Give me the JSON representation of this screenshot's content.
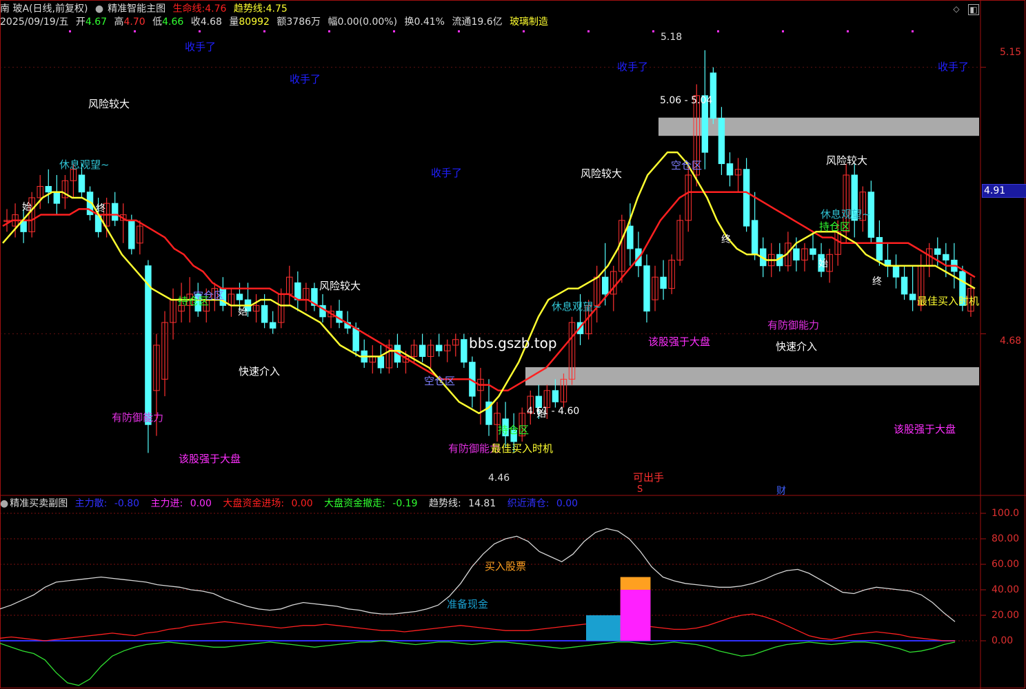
{
  "header": {
    "stock_name": "南 玻A(日线,前复权)",
    "indicator_name": "精准智能主图",
    "life_line_label": "生命线:",
    "life_line_value": "4.76",
    "trend_line_label": "趋势线:",
    "trend_line_value": "4.75",
    "date": "2025/09/19/五",
    "open_label": "开",
    "open_value": "4.67",
    "high_label": "高",
    "high_value": "4.70",
    "low_label": "低",
    "low_value": "4.66",
    "close_label": "收",
    "close_value": "4.68",
    "volume_label": "量",
    "volume_value": "80992",
    "amount_label": "额",
    "amount_value": "3786万",
    "change_label": "幅",
    "change_value": "0.00(0.00%)",
    "turnover_label": "换",
    "turnover_value": "0.41%",
    "float_label": "流通",
    "float_value": "19.6亿",
    "sector": "玻璃制造"
  },
  "sub_header": {
    "name": "精准买卖副图",
    "items": [
      {
        "label": "主力散:",
        "value": "-0.80",
        "color": "#3030ff"
      },
      {
        "label": "主力进:",
        "value": "0.00",
        "color": "#ff30ff"
      },
      {
        "label": "大盘资金进场:",
        "value": "0.00",
        "color": "#ff2020"
      },
      {
        "label": "大盘资金撤走:",
        "value": "-0.19",
        "color": "#30ff30"
      },
      {
        "label": "趋势线:",
        "value": "14.81",
        "color": "#e0e0e0"
      },
      {
        "label": "织近清仓:",
        "value": "0.00",
        "color": "#3030ff"
      }
    ]
  },
  "price_axis": {
    "ticks": [
      "5.15",
      "4.68"
    ],
    "current": "4.91"
  },
  "sub_axis": {
    "ticks": [
      "100.0",
      "80.00",
      "60.00",
      "40.00",
      "20.00",
      "0.00"
    ]
  },
  "annotations": {
    "shou_shou_le": "收手了",
    "risk_big": "风险较大",
    "rest_watch": "休息观望~",
    "empty_zone": "空仓区",
    "hold_zone": "持仓区",
    "defense": "有防御能力",
    "stronger": "该股强于大盘",
    "quick_enter": "快速介入",
    "best_buy": "最佳买入时机",
    "can_exit": "可出手",
    "start": "始",
    "end": "终",
    "cai": "财",
    "s_mark": "S",
    "watermark_site": "bbs.gszb.top",
    "high_mark": "5.18",
    "low_mark": "4.46",
    "range_top": "5.06 - 5.04",
    "range_bottom": "4.61 - 4.60",
    "buy_stock": "买入股票",
    "prepare_cash": "准备现金"
  },
  "chart_data": {
    "type": "candlestick",
    "ylim": [
      4.4,
      5.22
    ],
    "sub_ylim": [
      -35,
      105
    ],
    "colors": {
      "up": "#ff3030",
      "down": "#54ffff",
      "life_line": "#ff2020",
      "trend_line": "#ffff30",
      "zone": "#aaaaaa"
    },
    "zones": [
      [
        5.04,
        5.06
      ],
      [
        4.6,
        4.62
      ]
    ],
    "candles": [
      [
        4.88,
        4.9,
        4.86,
        4.88
      ],
      [
        4.87,
        4.91,
        4.85,
        4.89
      ],
      [
        4.88,
        4.9,
        4.84,
        4.86
      ],
      [
        4.86,
        4.93,
        4.85,
        4.92
      ],
      [
        4.92,
        4.96,
        4.9,
        4.94
      ],
      [
        4.94,
        4.97,
        4.91,
        4.93
      ],
      [
        4.93,
        4.96,
        4.89,
        4.91
      ],
      [
        4.92,
        4.96,
        4.9,
        4.95
      ],
      [
        4.95,
        4.98,
        4.92,
        4.97
      ],
      [
        4.96,
        4.98,
        4.92,
        4.93
      ],
      [
        4.93,
        4.94,
        4.88,
        4.89
      ],
      [
        4.89,
        4.92,
        4.85,
        4.86
      ],
      [
        4.87,
        4.92,
        4.85,
        4.91
      ],
      [
        4.91,
        4.93,
        4.87,
        4.88
      ],
      [
        4.88,
        4.91,
        4.84,
        4.89
      ],
      [
        4.88,
        4.89,
        4.82,
        4.83
      ],
      [
        4.84,
        4.88,
        4.82,
        4.87
      ],
      [
        4.8,
        4.81,
        4.47,
        4.52
      ],
      [
        4.58,
        4.68,
        4.5,
        4.66
      ],
      [
        4.6,
        4.72,
        4.57,
        4.7
      ],
      [
        4.7,
        4.76,
        4.67,
        4.74
      ],
      [
        4.72,
        4.77,
        4.7,
        4.73
      ],
      [
        4.73,
        4.78,
        4.7,
        4.75
      ],
      [
        4.75,
        4.77,
        4.71,
        4.72
      ],
      [
        4.72,
        4.76,
        4.7,
        4.74
      ],
      [
        4.74,
        4.77,
        4.72,
        4.76
      ],
      [
        4.76,
        4.78,
        4.72,
        4.73
      ],
      [
        4.73,
        4.76,
        4.71,
        4.75
      ],
      [
        4.75,
        4.77,
        4.72,
        4.74
      ],
      [
        4.74,
        4.77,
        4.71,
        4.72
      ],
      [
        4.72,
        4.75,
        4.7,
        4.73
      ],
      [
        4.73,
        4.75,
        4.69,
        4.7
      ],
      [
        4.7,
        4.72,
        4.68,
        4.69
      ],
      [
        4.7,
        4.76,
        4.69,
        4.75
      ],
      [
        4.75,
        4.8,
        4.73,
        4.78
      ],
      [
        4.77,
        4.79,
        4.72,
        4.74
      ],
      [
        4.74,
        4.77,
        4.72,
        4.76
      ],
      [
        4.76,
        4.77,
        4.72,
        4.73
      ],
      [
        4.73,
        4.75,
        4.7,
        4.71
      ],
      [
        4.71,
        4.73,
        4.69,
        4.72
      ],
      [
        4.72,
        4.74,
        4.69,
        4.7
      ],
      [
        4.7,
        4.72,
        4.68,
        4.69
      ],
      [
        4.69,
        4.7,
        4.64,
        4.65
      ],
      [
        4.65,
        4.67,
        4.62,
        4.63
      ],
      [
        4.63,
        4.66,
        4.61,
        4.64
      ],
      [
        4.64,
        4.66,
        4.61,
        4.62
      ],
      [
        4.62,
        4.67,
        4.61,
        4.66
      ],
      [
        4.66,
        4.68,
        4.62,
        4.63
      ],
      [
        4.63,
        4.65,
        4.61,
        4.64
      ],
      [
        4.64,
        4.67,
        4.63,
        4.66
      ],
      [
        4.66,
        4.68,
        4.63,
        4.64
      ],
      [
        4.64,
        4.67,
        4.62,
        4.66
      ],
      [
        4.66,
        4.68,
        4.64,
        4.65
      ],
      [
        4.65,
        4.67,
        4.63,
        4.66
      ],
      [
        4.66,
        4.68,
        4.64,
        4.67
      ],
      [
        4.67,
        4.68,
        4.62,
        4.63
      ],
      [
        4.63,
        4.64,
        4.55,
        4.57
      ],
      [
        4.58,
        4.62,
        4.52,
        4.6
      ],
      [
        4.56,
        4.6,
        4.5,
        4.52
      ],
      [
        4.52,
        4.56,
        4.49,
        4.54
      ],
      [
        4.53,
        4.56,
        4.48,
        4.5
      ],
      [
        4.51,
        4.54,
        4.47,
        4.49
      ],
      [
        4.5,
        4.55,
        4.49,
        4.54
      ],
      [
        4.54,
        4.58,
        4.52,
        4.57
      ],
      [
        4.57,
        4.59,
        4.53,
        4.55
      ],
      [
        4.55,
        4.59,
        4.53,
        4.58
      ],
      [
        4.58,
        4.6,
        4.55,
        4.56
      ],
      [
        4.56,
        4.61,
        4.55,
        4.6
      ],
      [
        4.6,
        4.71,
        4.59,
        4.7
      ],
      [
        4.7,
        4.75,
        4.66,
        4.68
      ],
      [
        4.68,
        4.74,
        4.67,
        4.73
      ],
      [
        4.73,
        4.8,
        4.7,
        4.78
      ],
      [
        4.78,
        4.84,
        4.73,
        4.75
      ],
      [
        4.75,
        4.8,
        4.72,
        4.79
      ],
      [
        4.79,
        4.89,
        4.77,
        4.88
      ],
      [
        4.87,
        4.91,
        4.8,
        4.83
      ],
      [
        4.83,
        4.86,
        4.78,
        4.8
      ],
      [
        4.8,
        4.82,
        4.7,
        4.72
      ],
      [
        4.74,
        4.8,
        4.72,
        4.78
      ],
      [
        4.78,
        4.81,
        4.74,
        4.76
      ],
      [
        4.76,
        4.82,
        4.75,
        4.81
      ],
      [
        4.81,
        4.89,
        4.8,
        4.88
      ],
      [
        4.88,
        4.98,
        4.86,
        4.96
      ],
      [
        4.96,
        5.12,
        4.94,
        5.1
      ],
      [
        5.1,
        5.18,
        4.97,
        5.0
      ],
      [
        5.14,
        5.15,
        5.05,
        5.06
      ],
      [
        5.06,
        5.08,
        4.96,
        4.98
      ],
      [
        4.98,
        5.0,
        4.94,
        4.96
      ],
      [
        4.96,
        4.99,
        4.93,
        4.97
      ],
      [
        4.97,
        4.99,
        4.86,
        4.87
      ],
      [
        4.88,
        4.93,
        4.81,
        4.82
      ],
      [
        4.83,
        4.85,
        4.78,
        4.8
      ],
      [
        4.8,
        4.84,
        4.78,
        4.82
      ],
      [
        4.82,
        4.84,
        4.79,
        4.8
      ],
      [
        4.8,
        4.86,
        4.79,
        4.84
      ],
      [
        4.83,
        4.85,
        4.79,
        4.81
      ],
      [
        4.81,
        4.84,
        4.79,
        4.83
      ],
      [
        4.83,
        4.86,
        4.81,
        4.82
      ],
      [
        4.82,
        4.84,
        4.78,
        4.79
      ],
      [
        4.79,
        4.83,
        4.77,
        4.82
      ],
      [
        4.82,
        4.88,
        4.8,
        4.86
      ],
      [
        4.86,
        4.98,
        4.84,
        4.96
      ],
      [
        4.96,
        4.98,
        4.85,
        4.88
      ],
      [
        4.88,
        4.94,
        4.86,
        4.93
      ],
      [
        4.93,
        4.95,
        4.84,
        4.85
      ],
      [
        4.85,
        4.88,
        4.8,
        4.81
      ],
      [
        4.81,
        4.84,
        4.78,
        4.8
      ],
      [
        4.8,
        4.82,
        4.76,
        4.78
      ],
      [
        4.78,
        4.8,
        4.74,
        4.75
      ],
      [
        4.75,
        4.8,
        4.72,
        4.74
      ],
      [
        4.73,
        4.82,
        4.72,
        4.8
      ],
      [
        4.8,
        4.84,
        4.78,
        4.83
      ],
      [
        4.83,
        4.85,
        4.8,
        4.82
      ],
      [
        4.82,
        4.84,
        4.78,
        4.81
      ],
      [
        4.81,
        4.84,
        4.76,
        4.79
      ],
      [
        4.79,
        4.8,
        4.72,
        4.73
      ],
      [
        4.72,
        4.78,
        4.71,
        4.76
      ]
    ],
    "life_line": [
      4.87,
      4.88,
      4.88,
      4.88,
      4.89,
      4.89,
      4.89,
      4.89,
      4.9,
      4.9,
      4.89,
      4.89,
      4.89,
      4.88,
      4.88,
      4.87,
      4.86,
      4.85,
      4.83,
      4.82,
      4.8,
      4.79,
      4.77,
      4.76,
      4.76,
      4.76,
      4.76,
      4.76,
      4.76,
      4.75,
      4.75,
      4.74,
      4.74,
      4.73,
      4.72,
      4.71,
      4.7,
      4.69,
      4.68,
      4.67,
      4.66,
      4.65,
      4.64,
      4.63,
      4.62,
      4.61,
      4.6,
      4.6,
      4.6,
      4.6,
      4.59,
      4.59,
      4.58,
      4.58,
      4.59,
      4.6,
      4.61,
      4.62,
      4.64,
      4.66,
      4.68,
      4.7,
      4.72,
      4.74,
      4.76,
      4.78,
      4.8,
      4.82,
      4.85,
      4.88,
      4.9,
      4.92,
      4.93,
      4.93,
      4.93,
      4.93,
      4.93,
      4.93,
      4.93,
      4.92,
      4.91,
      4.9,
      4.89,
      4.88,
      4.87,
      4.86,
      4.85,
      4.85,
      4.84,
      4.84,
      4.84,
      4.84,
      4.84,
      4.84,
      4.84,
      4.84,
      4.83,
      4.82,
      4.81,
      4.8,
      4.8,
      4.79,
      4.78
    ],
    "trend_line": [
      4.84,
      4.86,
      4.88,
      4.9,
      4.92,
      4.93,
      4.93,
      4.92,
      4.92,
      4.91,
      4.88,
      4.85,
      4.82,
      4.8,
      4.78,
      4.76,
      4.75,
      4.74,
      4.74,
      4.74,
      4.74,
      4.74,
      4.74,
      4.73,
      4.73,
      4.73,
      4.74,
      4.74,
      4.73,
      4.73,
      4.72,
      4.71,
      4.7,
      4.68,
      4.66,
      4.65,
      4.64,
      4.64,
      4.64,
      4.65,
      4.65,
      4.64,
      4.63,
      4.62,
      4.6,
      4.58,
      4.56,
      4.55,
      4.54,
      4.55,
      4.57,
      4.6,
      4.63,
      4.67,
      4.71,
      4.74,
      4.75,
      4.76,
      4.76,
      4.77,
      4.78,
      4.8,
      4.83,
      4.87,
      4.92,
      4.96,
      4.98,
      5.0,
      5.0,
      4.98,
      4.95,
      4.92,
      4.88,
      4.85,
      4.83,
      4.82,
      4.82,
      4.81,
      4.81,
      4.82,
      4.84,
      4.85,
      4.86,
      4.86,
      4.86,
      4.85,
      4.84,
      4.82,
      4.81,
      4.8,
      4.8,
      4.8,
      4.8,
      4.8,
      4.8,
      4.79,
      4.78,
      4.77,
      4.76
    ],
    "sub_white": [
      25,
      28,
      32,
      36,
      42,
      46,
      47,
      48,
      49,
      50,
      49,
      48,
      47,
      46,
      44,
      43,
      42,
      40,
      39,
      37,
      33,
      30,
      27,
      25,
      24,
      25,
      28,
      30,
      29,
      28,
      27,
      25,
      24,
      22,
      21,
      21,
      22,
      23,
      25,
      28,
      35,
      45,
      58,
      68,
      76,
      80,
      82,
      78,
      70,
      66,
      62,
      68,
      78,
      85,
      88,
      86,
      80,
      70,
      58,
      50,
      47,
      45,
      44,
      43,
      42,
      42,
      43,
      45,
      48,
      52,
      55,
      56,
      53,
      48,
      43,
      38,
      37,
      40,
      42,
      41,
      40,
      39,
      36,
      30,
      22,
      15
    ],
    "sub_red": [
      2,
      3,
      2,
      1,
      0,
      1,
      2,
      3,
      4,
      5,
      6,
      5,
      4,
      6,
      7,
      9,
      10,
      12,
      13,
      14,
      15,
      14,
      13,
      12,
      11,
      10,
      11,
      12,
      12,
      13,
      12,
      11,
      10,
      9,
      8,
      8,
      7,
      8,
      9,
      10,
      11,
      12,
      11,
      10,
      9,
      8,
      8,
      8,
      9,
      10,
      11,
      12,
      13,
      14,
      15,
      14,
      13,
      12,
      11,
      10,
      9,
      9,
      10,
      12,
      15,
      18,
      20,
      21,
      19,
      16,
      12,
      8,
      4,
      2,
      1,
      3,
      5,
      6,
      7,
      6,
      5,
      3,
      2,
      1,
      0,
      0
    ],
    "sub_green": [
      -2,
      -5,
      -8,
      -10,
      -15,
      -25,
      -33,
      -35,
      -30,
      -20,
      -12,
      -8,
      -5,
      -3,
      -2,
      -1,
      -2,
      -3,
      -4,
      -5,
      -5,
      -4,
      -3,
      -2,
      -1,
      -2,
      -3,
      -4,
      -5,
      -4,
      -3,
      -2,
      -1,
      -1,
      0,
      -1,
      -2,
      -3,
      -2,
      -1,
      -1,
      -2,
      -3,
      -2,
      -1,
      -1,
      -2,
      -3,
      -4,
      -5,
      -6,
      -5,
      -4,
      -3,
      -2,
      -1,
      -1,
      -2,
      -3,
      -2,
      -1,
      -2,
      -3,
      -5,
      -8,
      -10,
      -12,
      -11,
      -8,
      -5,
      -3,
      -2,
      -1,
      -2,
      -3,
      -2,
      -1,
      -1,
      -2,
      -4,
      -6,
      -9,
      -8,
      -6,
      -3,
      -1
    ],
    "sub_bars": [
      {
        "x": 0.5,
        "w": 0.035,
        "value": 20,
        "color": "#1aa0d0"
      },
      {
        "x": 0.535,
        "w": 0.028,
        "value": 50,
        "color": "#ffa020"
      },
      {
        "x": 0.535,
        "w": 0.028,
        "value": 40,
        "color": "#ff20ff"
      }
    ]
  }
}
